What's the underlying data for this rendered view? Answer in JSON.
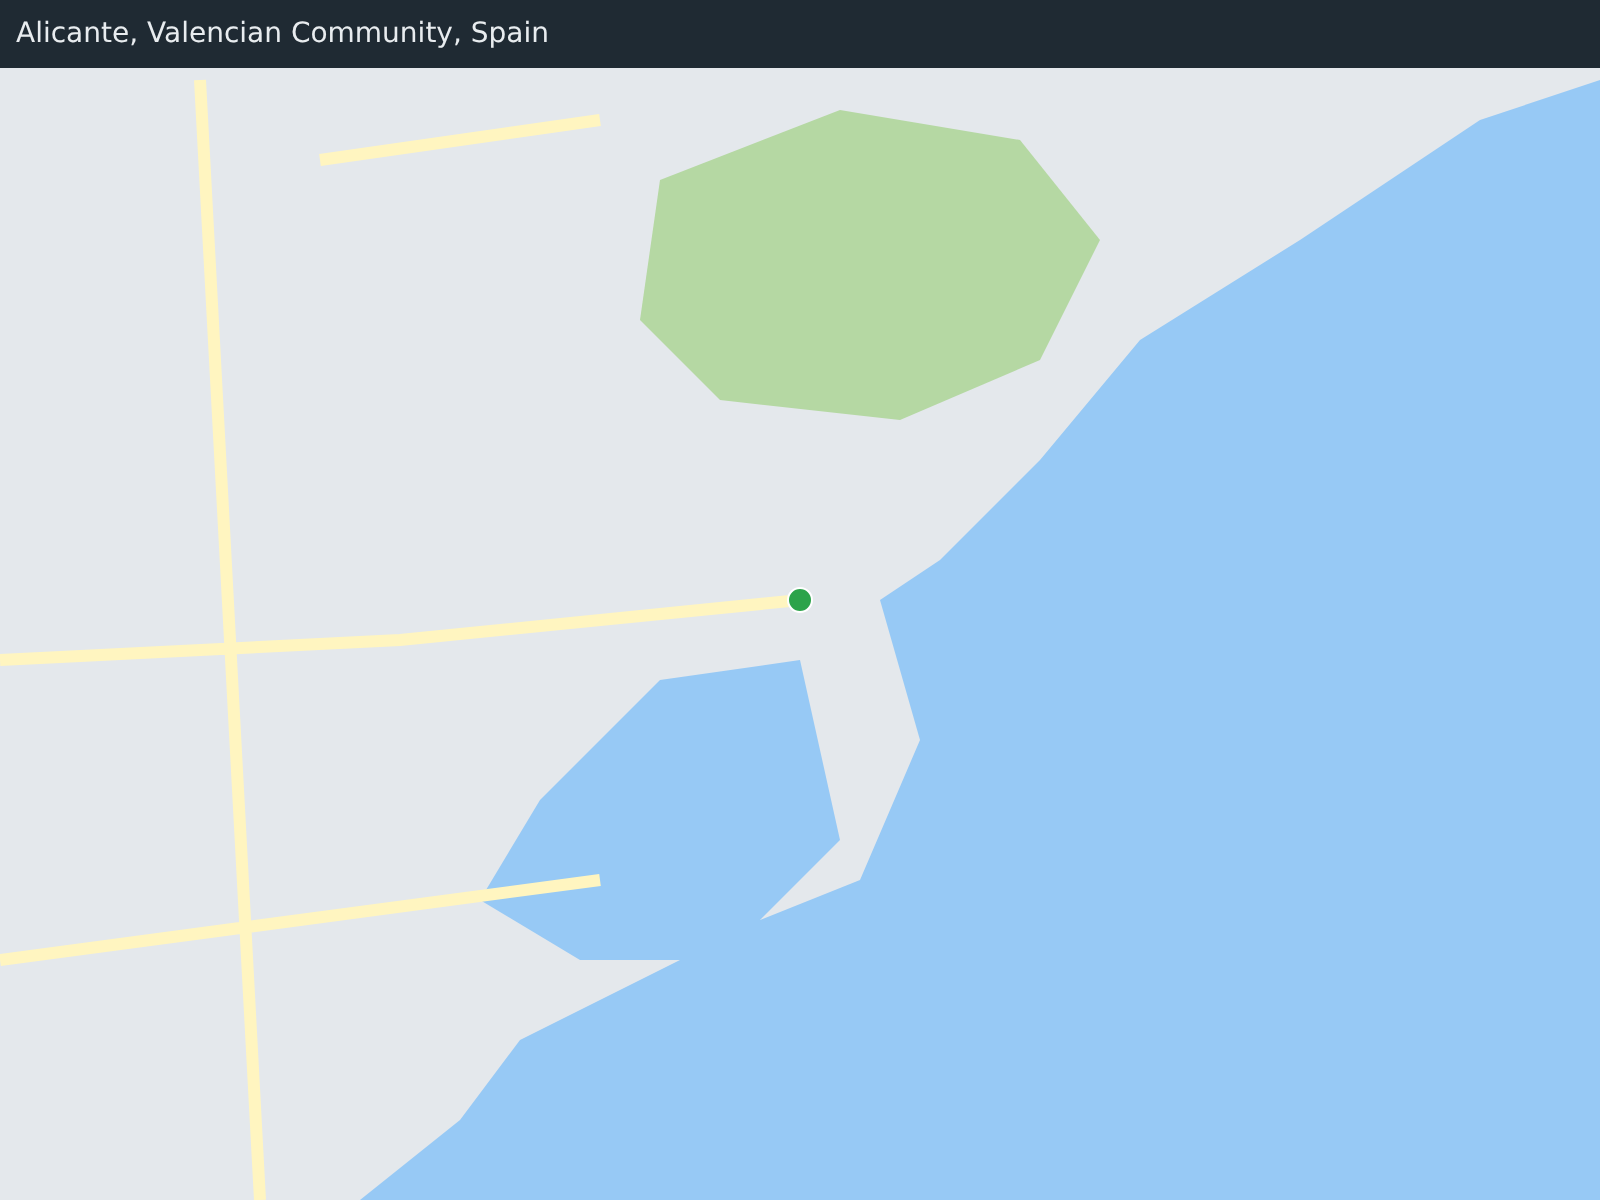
{
  "header": {
    "title": "Alicante, Valencian Community, Spain"
  }
}
